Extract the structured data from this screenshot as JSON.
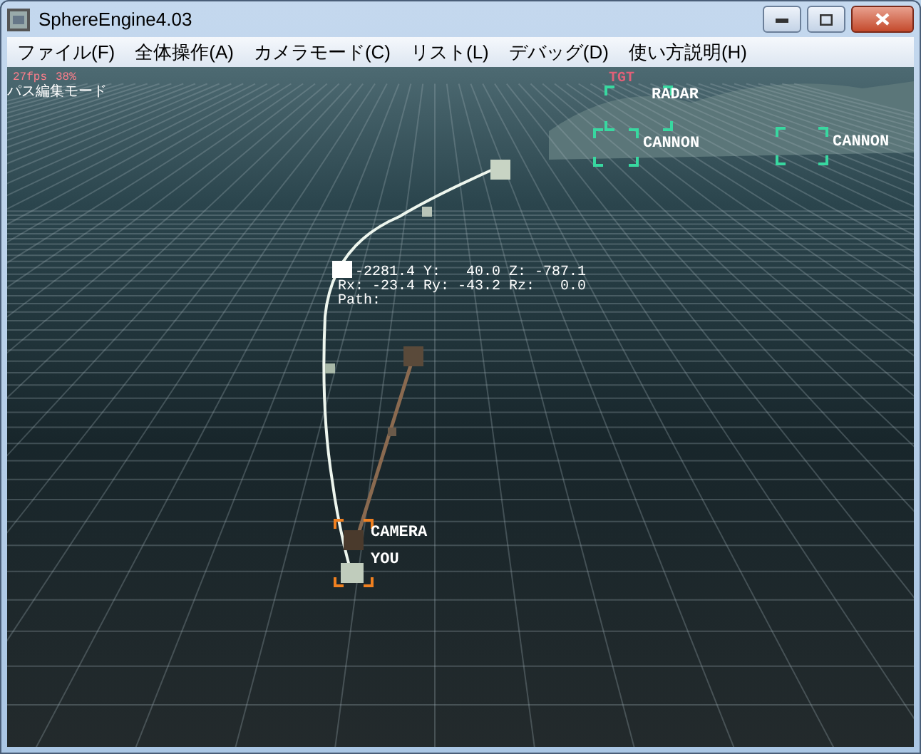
{
  "window": {
    "title": "SphereEngine4.03"
  },
  "menu": [
    {
      "label": "ファイル(F)"
    },
    {
      "label": "全体操作(A)"
    },
    {
      "label": "カメラモード(C)"
    },
    {
      "label": "リスト(L)"
    },
    {
      "label": "デバッグ(D)"
    },
    {
      "label": "使い方説明(H)"
    }
  ],
  "viewport": {
    "fps": "27fps",
    "load": "38%",
    "mode": "パス編集モード",
    "targets": [
      {
        "tag": "TGT",
        "label": "RADAR"
      },
      {
        "label": "CANNON"
      },
      {
        "label": "CANNON"
      }
    ],
    "readout": [
      "-2281.4 Y:   40.0 Z: -787.1",
      "Rx: -23.4 Ry: -43.2 Rz:   0.0",
      "Path:"
    ],
    "camera_label": "CAMERA",
    "player_label": "YOU"
  }
}
